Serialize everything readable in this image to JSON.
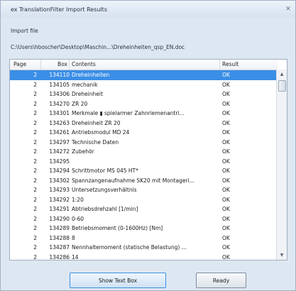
{
  "window": {
    "title": "ex TranslationFilter Import Results",
    "close_glyph": "✕"
  },
  "import": {
    "label": "Import file",
    "path": "C:\\Users\\hboscher\\Desktop\\Maschin...\\Dreheinheiten_qsp_EN.doc"
  },
  "table": {
    "columns": {
      "page": "Page",
      "box": "Box",
      "contents": "Contents",
      "result": "Result"
    },
    "rows": [
      {
        "page": "2",
        "box": "134110",
        "contents": "Dreheinheiten",
        "result": "OK",
        "selected": true
      },
      {
        "page": "2",
        "box": "134105",
        "contents": "mechanik",
        "result": "OK"
      },
      {
        "page": "2",
        "box": "134306",
        "contents": "Dreheinheit",
        "result": "OK"
      },
      {
        "page": "2",
        "box": "134270",
        "contents": "ZR 20",
        "result": "OK"
      },
      {
        "page": "2",
        "box": "134301",
        "contents": "Merkmale  ▮ spielarmer Zahnriemenantri...",
        "result": "OK"
      },
      {
        "page": "2",
        "box": "134263",
        "contents": "Dreheinheit ZR 20",
        "result": "OK"
      },
      {
        "page": "2",
        "box": "134261",
        "contents": "Antriebsmodul MD 24",
        "result": "OK"
      },
      {
        "page": "2",
        "box": "134297",
        "contents": "Technische Daten",
        "result": "OK"
      },
      {
        "page": "2",
        "box": "134272",
        "contents": "Zubehör",
        "result": "OK"
      },
      {
        "page": "2",
        "box": "134295",
        "contents": "",
        "result": "OK"
      },
      {
        "page": "2",
        "box": "134294",
        "contents": "Schrittmotor  MS 045 HT*",
        "result": "OK"
      },
      {
        "page": "2",
        "box": "134302",
        "contents": "Spannzangenaufnahme SK20 mit Montageri...",
        "result": "OK"
      },
      {
        "page": "2",
        "box": "134293",
        "contents": "Untersetzungsverhältnis",
        "result": "OK"
      },
      {
        "page": "2",
        "box": "134292",
        "contents": "1:20",
        "result": "OK"
      },
      {
        "page": "2",
        "box": "134291",
        "contents": "Abtriebsdrehzahl [1/min]",
        "result": "OK"
      },
      {
        "page": "2",
        "box": "134290",
        "contents": "0-60",
        "result": "OK"
      },
      {
        "page": "2",
        "box": "134289",
        "contents": "Betriebsmoment (0-1600Hz) [Nm]",
        "result": "OK"
      },
      {
        "page": "2",
        "box": "134288",
        "contents": "8",
        "result": "OK"
      },
      {
        "page": "2",
        "box": "134287",
        "contents": "Nennhaltemoment (statische Belastung) ...",
        "result": "OK"
      },
      {
        "page": "2",
        "box": "134286",
        "contents": "14",
        "result": "OK"
      }
    ],
    "scroll_up_glyph": "▲",
    "scroll_down_glyph": "▼"
  },
  "buttons": {
    "show_text_box": "Show Text Box",
    "ready": "Ready"
  },
  "colors": {
    "selection": "#3b8ee6",
    "window_bg": "#dde7f1"
  }
}
